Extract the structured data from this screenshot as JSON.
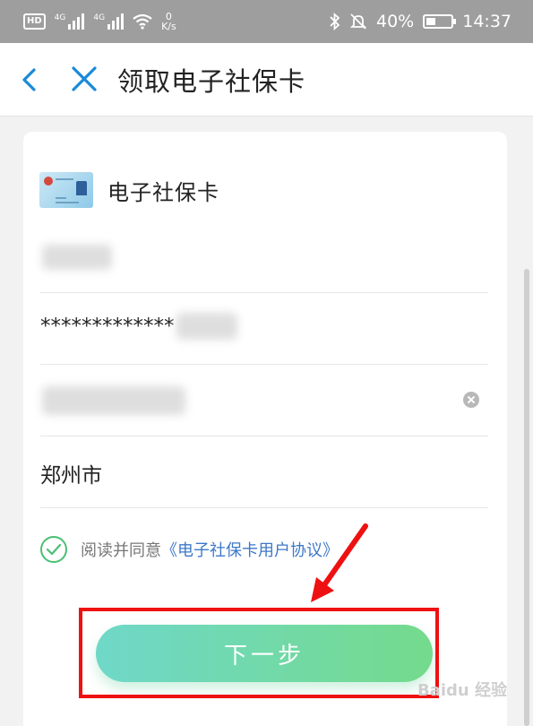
{
  "status_bar": {
    "hd": "HD",
    "net1": "4G",
    "net2": "4G",
    "speed_value": "0",
    "speed_unit": "K/s",
    "battery": "40%",
    "battery_level": 0.4,
    "time": "14:37"
  },
  "header": {
    "title": "领取电子社保卡",
    "back_icon": "chevron-left-icon",
    "close_icon": "close-icon"
  },
  "card": {
    "name": "电子社保卡",
    "thumbnail_icon": "social-security-card-icon"
  },
  "form": {
    "id_number_visible": "*************",
    "city": "郑州市"
  },
  "agreement": {
    "prefix": "阅读并同意",
    "link": "《电子社保卡用户协议》",
    "checked": true
  },
  "next_button": {
    "label": "下一步"
  },
  "watermark": "Baidu 经验",
  "colors": {
    "accent_blue": "#1a8ad8",
    "link_blue": "#3e78c8",
    "check_green": "#4bbf73",
    "button_start": "#6fd8c8",
    "button_end": "#74da8c",
    "highlight_red": "#ee1111"
  }
}
